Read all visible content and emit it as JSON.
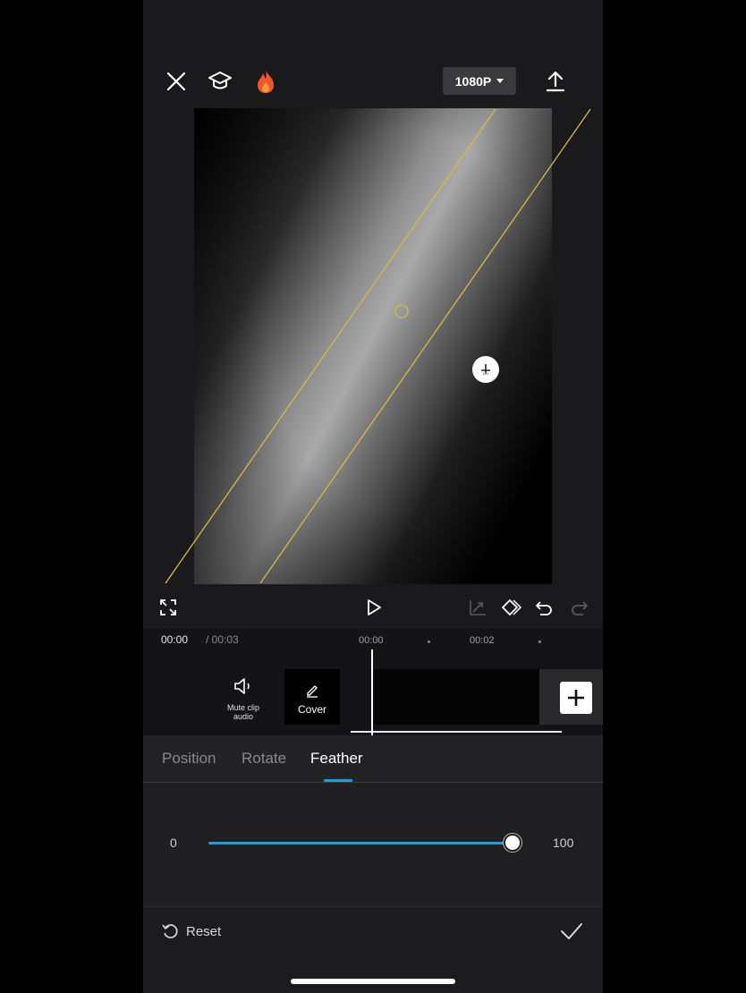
{
  "top_bar": {
    "resolution_label": "1080P",
    "icons": [
      "close-icon",
      "graduation-cap-icon",
      "fire-icon",
      "export-icon"
    ]
  },
  "controls": {
    "icons": [
      "fullscreen-icon",
      "play-icon",
      "keyframe-graph-icon",
      "keyframe-add-icon",
      "undo-icon",
      "redo-icon"
    ]
  },
  "timeline": {
    "current_time": "00:00",
    "total_time": "/ 00:03",
    "ticks": [
      "00:00",
      "00:02"
    ]
  },
  "track": {
    "mute_label": "Mute clip audio",
    "cover_label": "Cover"
  },
  "tabs": [
    {
      "label": "Position",
      "active": false
    },
    {
      "label": "Rotate",
      "active": false
    },
    {
      "label": "Feather",
      "active": true
    }
  ],
  "feather_slider": {
    "min_label": "0",
    "max_label": "100",
    "value": 100
  },
  "bottom_bar": {
    "reset_label": "Reset"
  },
  "colors": {
    "accent": "#1f9fd6",
    "mask_line": "#d4bb45",
    "panel": "#232325"
  }
}
